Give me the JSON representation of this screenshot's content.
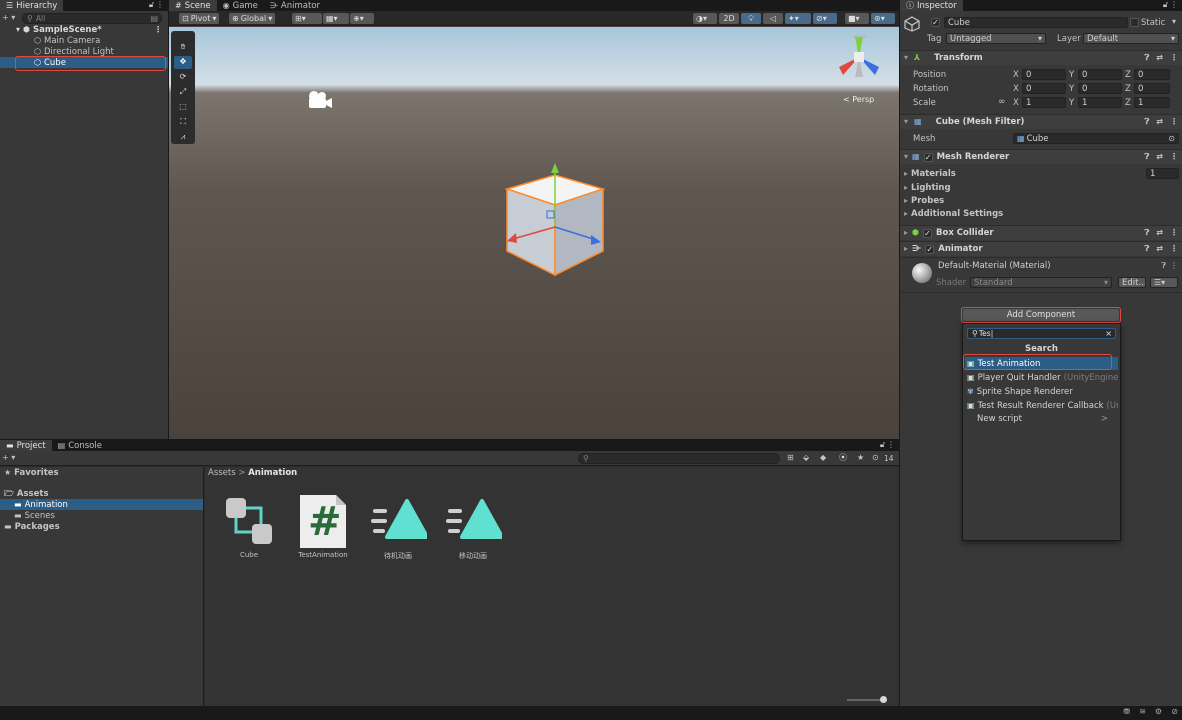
{
  "colors": {
    "accent": "#2c5d87",
    "selection": "#2c5d87",
    "highlight": "#e0483f"
  },
  "hierarchy": {
    "tab": "Hierarchy",
    "search_placeholder": "All",
    "add_label": "+ ▾",
    "scene": "SampleScene*",
    "items": [
      "Main Camera",
      "Directional Light",
      "Cube"
    ]
  },
  "scene_view": {
    "tabs": [
      "Scene",
      "Game",
      "Animator"
    ],
    "pivot": "Pivot",
    "global": "Global",
    "mode_2d": "2D",
    "persp": "< Persp",
    "tools": [
      "hand-icon",
      "move-icon",
      "rotate-icon",
      "scale-icon",
      "rect-icon",
      "transform-icon",
      "custom-tool-icon"
    ]
  },
  "project": {
    "tabs": [
      "Project",
      "Console"
    ],
    "add_label": "+ ▾",
    "favorites": "Favorites",
    "assets": "Assets",
    "folders": [
      "Animation",
      "Scenes"
    ],
    "packages": "Packages",
    "breadcrumb_root": "Assets",
    "breadcrumb_sep": ">",
    "breadcrumb_current": "Animation",
    "hidden_count": "14",
    "items": [
      {
        "name": "Cube",
        "icon": "animator-controller-icon"
      },
      {
        "name": "TestAnimation",
        "icon": "csharp-script-icon",
        "glyph": "#"
      },
      {
        "name": "待机动画",
        "icon": "animation-clip-icon"
      },
      {
        "name": "移动动画",
        "icon": "animation-clip-icon"
      }
    ]
  },
  "inspector": {
    "tab": "Inspector",
    "object_name": "Cube",
    "static_label": "Static",
    "tag_label": "Tag",
    "tag_value": "Untagged",
    "layer_label": "Layer",
    "layer_value": "Default",
    "transform": {
      "title": "Transform",
      "rows": [
        {
          "label": "Position",
          "x": "0",
          "y": "0",
          "z": "0"
        },
        {
          "label": "Rotation",
          "x": "0",
          "y": "0",
          "z": "0"
        },
        {
          "label": "Scale",
          "x": "1",
          "y": "1",
          "z": "1"
        }
      ],
      "axes": [
        "X",
        "Y",
        "Z"
      ]
    },
    "mesh_filter": {
      "title": "Cube (Mesh Filter)",
      "mesh_label": "Mesh",
      "mesh_value": "Cube"
    },
    "mesh_renderer": {
      "title": "Mesh Renderer",
      "materials": "Materials",
      "materials_count": "1",
      "lighting": "Lighting",
      "probes": "Probes",
      "additional": "Additional Settings"
    },
    "box_collider": "Box Collider",
    "animator": "Animator",
    "material": {
      "name": "Default-Material (Material)",
      "shader_label": "Shader",
      "shader_value": "Standard",
      "edit": "Edit..."
    },
    "add_component": "Add Component"
  },
  "popup": {
    "search_value": "Tes",
    "header": "Search",
    "items": [
      {
        "label": "Test Animation",
        "suffix": "",
        "icon": "script-icon"
      },
      {
        "label": "Player Quit Handler",
        "suffix": " (UnityEngine.Tes",
        "icon": "script-icon"
      },
      {
        "label": "Sprite Shape Renderer",
        "suffix": "",
        "icon": "sprite-shape-icon"
      },
      {
        "label": "Test Result Renderer Callback",
        "suffix": " (Unity",
        "icon": "script-icon"
      }
    ],
    "new_script": "New script",
    "new_script_arrow": ">"
  }
}
